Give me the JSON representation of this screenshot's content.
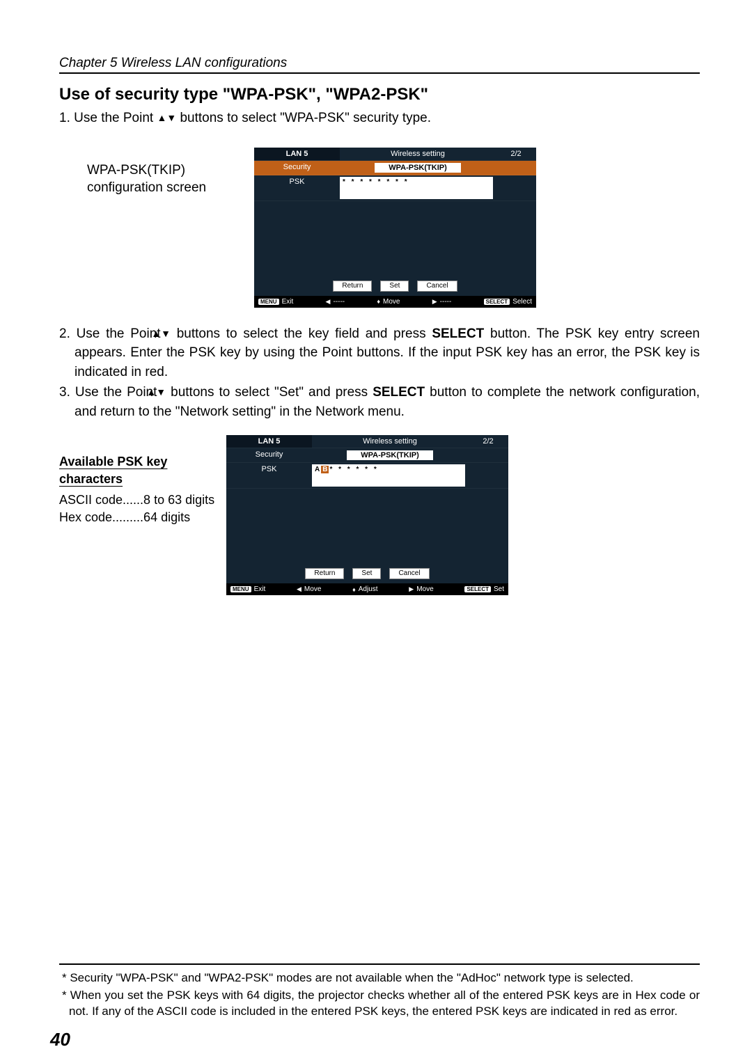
{
  "chapter": "Chapter 5 Wireless LAN configurations",
  "section_title": "Use of security type \"WPA-PSK\", \"WPA2-PSK\"",
  "step1_a": "1. Use the Point ",
  "step1_b": " buttons to select \"WPA-PSK\" security type.",
  "screen1_caption": "WPA-PSK(TKIP) configuration screen",
  "screen": {
    "lan": "LAN 5",
    "title": "Wireless setting",
    "page": "2/2",
    "security_lbl": "Security",
    "security_val": "WPA-PSK(TKIP)",
    "psk_lbl": "PSK",
    "psk_masked": "* * * * * * * *",
    "btn_return": "Return",
    "btn_set": "Set",
    "btn_cancel": "Cancel",
    "f_menu": "MENU",
    "f_exit": "Exit",
    "f_dash": "-----",
    "f_move": "Move",
    "f_select_badge": "SELECT",
    "f_select": "Select"
  },
  "step2_a": "2. Use the Point ",
  "step2_b": " buttons to select the key field and press ",
  "step2_select": "SELECT",
  "step2_c": " button. The PSK key entry screen appears. Enter the PSK key by using the Point buttons. If the input PSK key has an error, the PSK key is indicated in red.",
  "step3_a": "3. Use the Point ",
  "step3_b": " buttons to select \"Set\" and press ",
  "step3_select": "SELECT",
  "step3_c": " button to complete the network configuration, and return to the \"Network setting\" in the Network menu.",
  "avail_head": "Available PSK key characters",
  "avail_ascii": "ASCII code......8 to 63 digits",
  "avail_hex": "Hex code.........64 digits",
  "screen2": {
    "psk_tail": "* * * * * *",
    "f_adjust": "Adjust",
    "f_set": "Set"
  },
  "footnote1": "* Security \"WPA-PSK\" and \"WPA2-PSK\" modes are not available when the \"AdHoc\" network type is selected.",
  "footnote2": "* When you set the PSK keys with 64 digits, the projector checks whether all of the entered PSK keys are in Hex code or not. If any of the ASCII code is included in the entered PSK keys, the entered PSK keys are indicated in red as error.",
  "pagenum": "40"
}
